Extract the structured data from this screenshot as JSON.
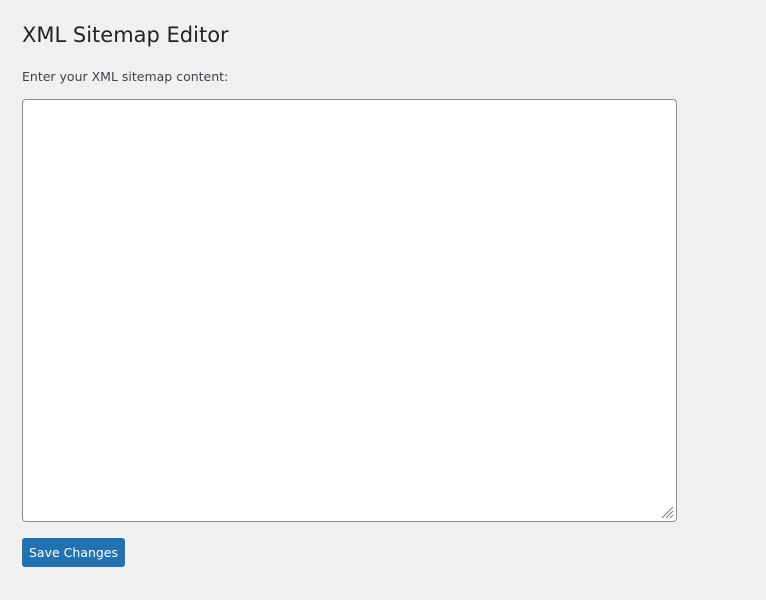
{
  "page": {
    "title": "XML Sitemap Editor"
  },
  "form": {
    "label": "Enter your XML sitemap content:",
    "textarea_value": "",
    "save_label": "Save Changes"
  },
  "icons": {
    "resize_handle": "resize-grip-icon"
  },
  "colors": {
    "background": "#f0f0f1",
    "primary_button": "#2271b1",
    "textarea_border": "#8c8f94"
  }
}
